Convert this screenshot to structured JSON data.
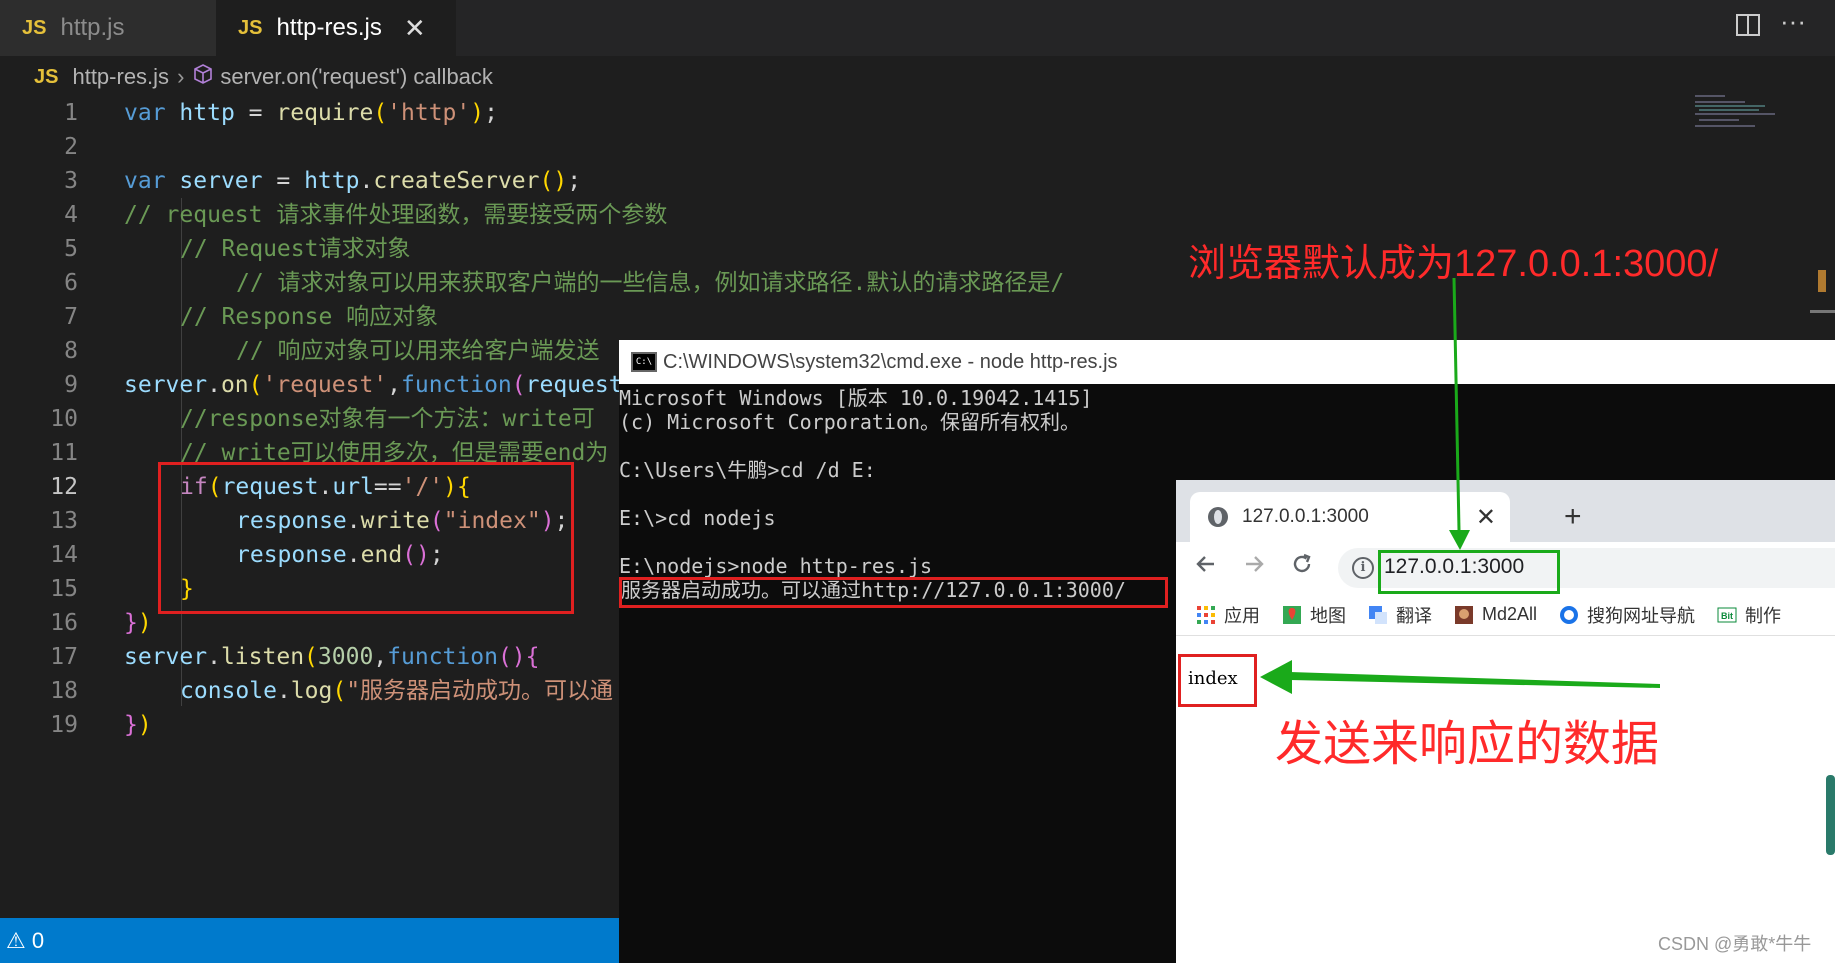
{
  "editor": {
    "tabs": [
      {
        "icon": "JS",
        "label": "http.js"
      },
      {
        "icon": "JS",
        "label": "http-res.js",
        "close": "✕"
      }
    ],
    "breadcrumb": {
      "file": "http-res.js",
      "sep": "›",
      "symbol": "server.on('request') callback"
    },
    "status": {
      "problems": "⚠ 0"
    },
    "line_numbers": [
      "1",
      "2",
      "3",
      "4",
      "5",
      "6",
      "7",
      "8",
      "9",
      "10",
      "11",
      "12",
      "13",
      "14",
      "15",
      "16",
      "17",
      "18",
      "19"
    ],
    "active_line": "12"
  },
  "cmd": {
    "title": "C:\\WINDOWS\\system32\\cmd.exe - node  http-res.js",
    "icon_text": "C:\\",
    "lines": [
      "Microsoft Windows [版本 10.0.19042.1415]",
      "(c) Microsoft Corporation。保留所有权利。",
      "",
      "C:\\Users\\牛鹏>cd /d E:",
      "",
      "E:\\>cd nodejs",
      "",
      "E:\\nodejs>node http-res.js",
      "服务器启动成功。可以通过http://127.0.0.1:3000/"
    ]
  },
  "browser": {
    "tab_title": "127.0.0.1:3000",
    "tab_close": "✕",
    "new_tab": "+",
    "url": "127.0.0.1:3000",
    "bookmarks": [
      "应用",
      "地图",
      "翻译",
      "Md2All",
      "搜狗网址导航",
      "制作"
    ],
    "page_text": "index"
  },
  "annotations": {
    "top": "浏览器默认成为127.0.0.1:3000/",
    "bottom": "发送来响应的数据"
  },
  "watermark": "CSDN @勇敢*牛牛",
  "colors": {
    "annotation_red": "#e02020",
    "annotation_green": "#1aaa1a",
    "status_bar": "#007acc"
  }
}
